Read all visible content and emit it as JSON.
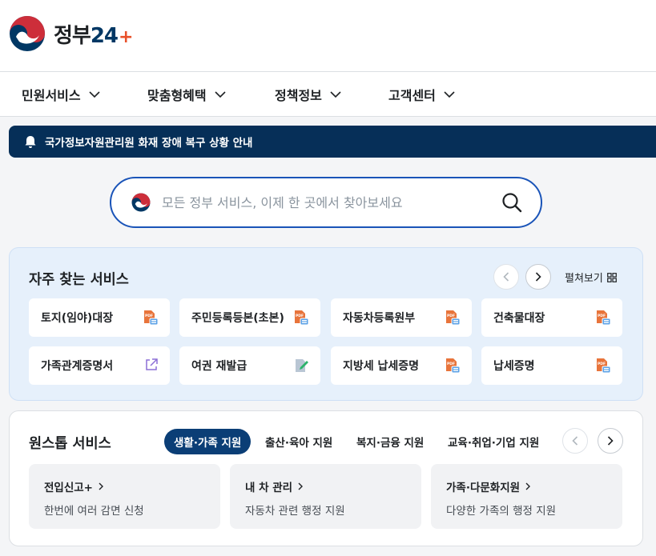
{
  "brand": {
    "logo_text": "정부",
    "logo_number": "24",
    "logo_plus": "+"
  },
  "nav": [
    {
      "label": "민원서비스"
    },
    {
      "label": "맞춤형혜택"
    },
    {
      "label": "정책정보"
    },
    {
      "label": "고객센터"
    }
  ],
  "notice": {
    "icon": "bell-icon",
    "text": "국가정보자원관리원 화재 장애 복구 상황 안내"
  },
  "search": {
    "placeholder": "모든 정부 서비스, 이제 한 곳에서 찾아보세요",
    "value": ""
  },
  "frequent": {
    "title": "자주 찾는 서비스",
    "expand_label": "펼쳐보기",
    "items": [
      {
        "label": "토지(임야)대장",
        "icon": "pdf-document-icon"
      },
      {
        "label": "주민등록등본(초본)",
        "icon": "pdf-document-icon"
      },
      {
        "label": "자동차등록원부",
        "icon": "pdf-document-icon"
      },
      {
        "label": "건축물대장",
        "icon": "pdf-document-icon"
      },
      {
        "label": "가족관계증명서",
        "icon": "external-link-icon"
      },
      {
        "label": "여권 재발급",
        "icon": "edit-document-icon"
      },
      {
        "label": "지방세 납세증명",
        "icon": "pdf-document-icon"
      },
      {
        "label": "납세증명",
        "icon": "pdf-document-icon"
      }
    ]
  },
  "onestop": {
    "title": "원스톱 서비스",
    "tabs": [
      {
        "label": "생활·가족 지원",
        "active": true
      },
      {
        "label": "출산·육아 지원",
        "active": false
      },
      {
        "label": "복지·금융 지원",
        "active": false
      },
      {
        "label": "교육·취업·기업 지원",
        "active": false
      }
    ],
    "cards": [
      {
        "title": "전입신고+",
        "desc": "한번에 여러 감면 신청"
      },
      {
        "title": "내 차 관리",
        "desc": "자동차 관련 행정 지원"
      },
      {
        "title": "가족·다문화지원",
        "desc": "다양한 가족의 행정 지원"
      }
    ]
  },
  "colors": {
    "accent": "#0b3e76",
    "notice_bg": "#062f58",
    "search_border": "#1a54b8",
    "freq_bg": "#e6f0fb",
    "pdf_icon": "#e8743b"
  }
}
